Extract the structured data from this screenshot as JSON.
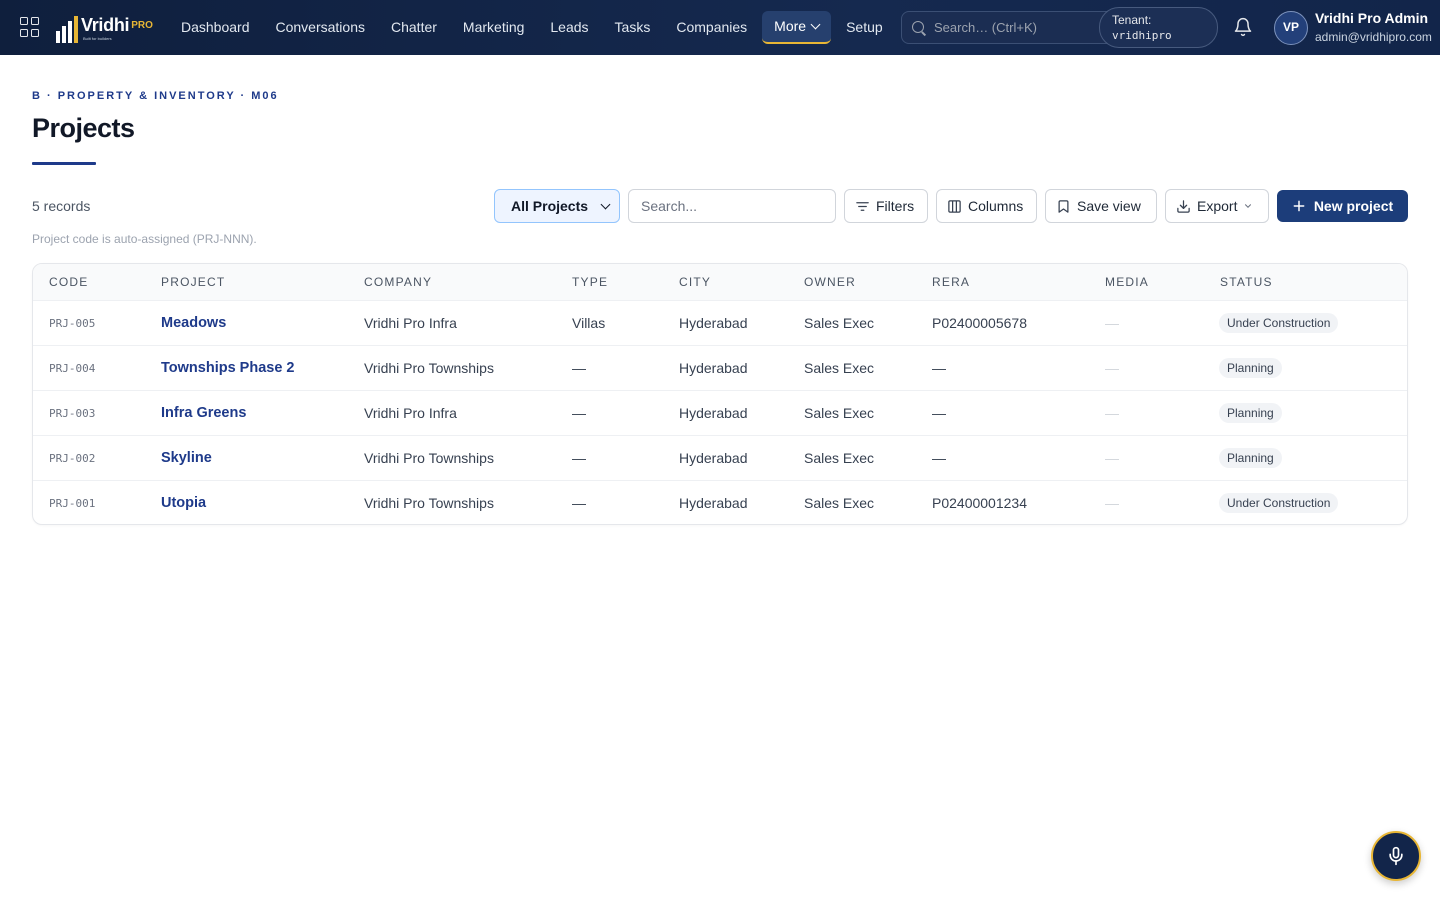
{
  "brand": {
    "name": "Vridhi",
    "suffix": "PRO",
    "tagline": "Built for builders"
  },
  "nav": {
    "items": [
      "Dashboard",
      "Conversations",
      "Chatter",
      "Marketing",
      "Leads",
      "Tasks",
      "Companies"
    ],
    "more_label": "More",
    "setup_label": "Setup"
  },
  "search": {
    "placeholder": "Search… (Ctrl+K)"
  },
  "tenant": {
    "label": "Tenant:",
    "value": "vridhipro"
  },
  "user": {
    "initials": "VP",
    "name": "Vridhi Pro Admin",
    "email": "admin@vridhipro.com"
  },
  "page": {
    "eyebrow": "B · PROPERTY & INVENTORY · M06",
    "title": "Projects",
    "records": "5 records",
    "hint": "Project code is auto-assigned (PRJ-NNN)."
  },
  "toolbar": {
    "view_select": "All Projects",
    "search_placeholder": "Search...",
    "filters": "Filters",
    "columns": "Columns",
    "save_view": "Save view",
    "export": "Export",
    "new_project": "New project"
  },
  "table": {
    "headers": [
      "CODE",
      "PROJECT",
      "COMPANY",
      "TYPE",
      "CITY",
      "OWNER",
      "RERA",
      "MEDIA",
      "STATUS"
    ],
    "rows": [
      {
        "code": "PRJ-005",
        "project": "Meadows",
        "company": "Vridhi Pro Infra",
        "type": "Villas",
        "city": "Hyderabad",
        "owner": "Sales Exec",
        "rera": "P02400005678",
        "media": "—",
        "status": "Under Construction"
      },
      {
        "code": "PRJ-004",
        "project": "Townships Phase 2",
        "company": "Vridhi Pro Townships",
        "type": "—",
        "city": "Hyderabad",
        "owner": "Sales Exec",
        "rera": "—",
        "media": "—",
        "status": "Planning"
      },
      {
        "code": "PRJ-003",
        "project": "Infra Greens",
        "company": "Vridhi Pro Infra",
        "type": "—",
        "city": "Hyderabad",
        "owner": "Sales Exec",
        "rera": "—",
        "media": "—",
        "status": "Planning"
      },
      {
        "code": "PRJ-002",
        "project": "Skyline",
        "company": "Vridhi Pro Townships",
        "type": "—",
        "city": "Hyderabad",
        "owner": "Sales Exec",
        "rera": "—",
        "media": "—",
        "status": "Planning"
      },
      {
        "code": "PRJ-001",
        "project": "Utopia",
        "company": "Vridhi Pro Townships",
        "type": "—",
        "city": "Hyderabad",
        "owner": "Sales Exec",
        "rera": "P02400001234",
        "media": "—",
        "status": "Under Construction"
      }
    ]
  },
  "colors": {
    "nav_bg": "#12254a",
    "accent_gold": "#e8b635",
    "primary": "#1c3d7a",
    "link": "#1e3a8a"
  }
}
